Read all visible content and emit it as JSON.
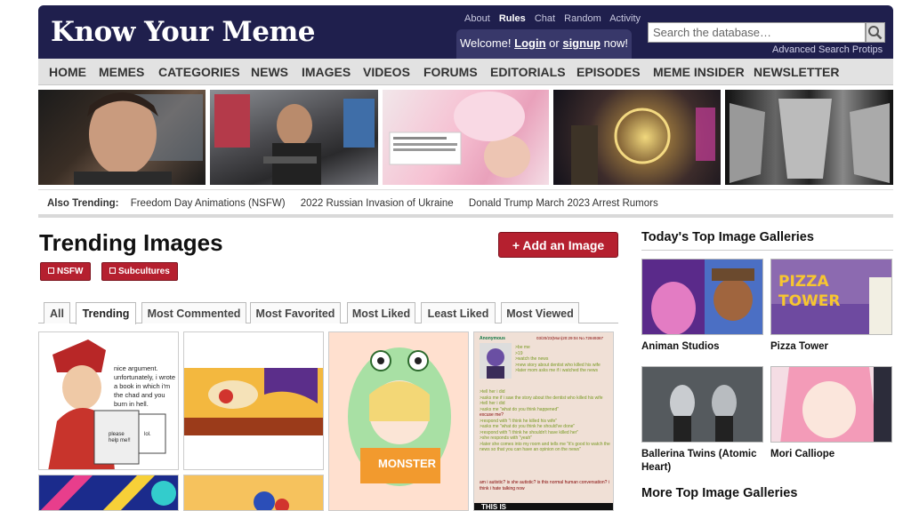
{
  "header": {
    "logo": "Know Your Meme",
    "top_links": [
      "About",
      "Rules",
      "Chat",
      "Random",
      "Activity"
    ],
    "welcome_prefix": "Welcome!",
    "login": "Login",
    "or": "or",
    "signup": "signup",
    "now": "now!",
    "search_placeholder": "Search the database…",
    "advanced_search": "Advanced Search Protips"
  },
  "nav": [
    "HOME",
    "MEMES",
    "CATEGORIES",
    "NEWS",
    "IMAGES",
    "VIDEOS",
    "FORUMS",
    "EDITORIALS",
    "EPISODES",
    "MEME INSIDER",
    "NEWSLETTER"
  ],
  "trending": {
    "label": "Also Trending:",
    "items": [
      "Freedom Day Animations (NSFW)",
      "2022 Russian Invasion of Ukraine",
      "Donald Trump March 2023 Arrest Rumors"
    ]
  },
  "main": {
    "title": "Trending Images",
    "add_button": "+ Add an Image",
    "filters": [
      "NSFW",
      "Subcultures"
    ],
    "tabs": [
      "All",
      "Trending",
      "Most Commented",
      "Most Favorited",
      "Most Liked",
      "Least Liked",
      "Most Viewed"
    ],
    "active_tab": "Trending"
  },
  "comic": {
    "speech": "nice argument. unfortunately, i wrote a book in which i'm the chad and you burn in hell.",
    "book_left": "please help me!!",
    "book_right": "lol."
  },
  "monster": {
    "shirt": "MONSTER"
  },
  "greentext": {
    "name": "Anonymous",
    "meta": "03/20/23(Mon)20:29:04 No.72849367",
    "lines_right": [
      ">be me",
      ">19",
      ">watch the news",
      ">new story about dentist who killed his wife",
      ">later mom asks me if i watched the news"
    ],
    "lines": [
      ">tell her i did",
      ">asks me if i saw the story about the dentist who killed his wife",
      ">tell her i did",
      ">asks me \"what do you think happened\"",
      "excuse me?",
      ">respond with \"i think he killed his wife\"",
      ">asks me \"what do you think he should've done\"",
      ">respond with \"i think he shouldn't have killed her\"",
      ">she responds with \"yeah\"",
      ">later she comes into my room and tells me \"it's good to watch the news so that you can have an opinion on the news\""
    ],
    "footer": "am i autistic? is she autistic? is this normal human conversation? i think i hate talking now",
    "bottom_banner": "THIS IS"
  },
  "sidebar": {
    "top_title": "Today's Top Image Galleries",
    "galleries": [
      {
        "label": "Animan Studios"
      },
      {
        "label": "Pizza Tower"
      },
      {
        "label": "Ballerina Twins (Atomic Heart)"
      },
      {
        "label": "Mori Calliope"
      }
    ],
    "pizza_text": "PIZZA TOWER",
    "more_title": "More Top Image Galleries"
  }
}
